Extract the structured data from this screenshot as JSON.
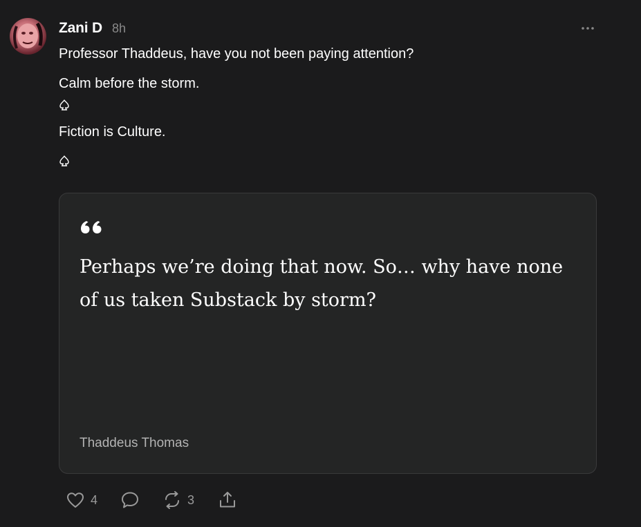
{
  "post": {
    "author": "Zani D",
    "time": "8h",
    "lines": [
      "Professor Thaddeus, have you not been paying attention?",
      "Calm before the storm.",
      "Fiction is Culture."
    ]
  },
  "quote": {
    "text": "Perhaps we’re doing that now. So… why have none of us taken Substack by storm?",
    "author": "Thaddeus Thomas"
  },
  "actions": {
    "likes": "4",
    "restacks": "3"
  },
  "icons": {
    "more": "more-horizontal-icon",
    "spade": "spade-icon",
    "quote": "quote-mark-icon",
    "like": "heart-icon",
    "comment": "comment-icon",
    "restack": "restack-icon",
    "share": "share-icon"
  },
  "colors": {
    "background": "#1b1b1c",
    "card": "#242525",
    "muted": "#8a8a8a"
  }
}
